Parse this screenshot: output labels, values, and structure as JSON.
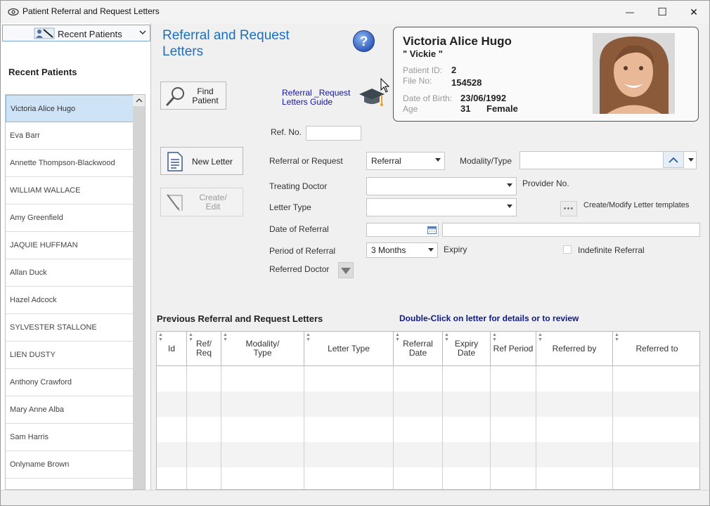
{
  "window": {
    "title": "Patient Referral and Request Letters",
    "app_icon": "eye-icon",
    "minimize_glyph": "—",
    "maximize_glyph": "☐",
    "close_glyph": "✕"
  },
  "sidebar": {
    "combo_label": "Recent Patients",
    "heading": "Recent Patients",
    "patients": [
      "Victoria Alice Hugo",
      "Eva Barr",
      "Annette Thompson-Blackwood",
      "WILLIAM WALLACE",
      "Amy Greenfield",
      "JAQUIE HUFFMAN",
      "Allan  Duck",
      "Hazel Adcock",
      "SYLVESTER STALLONE",
      "LIEN DUSTY",
      "Anthony Crawford",
      "Mary Anne Alba",
      "Sam Harris",
      "Onlyname  Brown"
    ],
    "selected_index": 0
  },
  "header": {
    "title_line1": "Referral and Request",
    "title_line2": "Letters",
    "guide_line1": "Referral _Request",
    "guide_line2": "Letters Guide"
  },
  "buttons": {
    "find_line1": "Find",
    "find_line2": "Patient",
    "new_letter": "New Letter",
    "create_line1": "Create/",
    "create_line2": "Edit"
  },
  "patient": {
    "name": "Victoria Alice Hugo",
    "nickname": "\" Vickie \"",
    "id_label": "Patient ID:",
    "id_value": "2",
    "file_label": "File No:",
    "file_value": "154528",
    "dob_label": "Date of Birth:",
    "dob_value": "23/06/1992",
    "age_label": "Age",
    "age_value": "31",
    "gender": "Female"
  },
  "form": {
    "ref_no_label": "Ref. No.",
    "ref_no_value": "",
    "referral_or_request_label": "Referral or Request",
    "referral_or_request_value": "Referral",
    "modality_label": "Modality/Type",
    "modality_value": "",
    "treating_doctor_label": "Treating Doctor",
    "treating_doctor_value": "",
    "provider_no_label": "Provider No.",
    "letter_type_label": "Letter Type",
    "letter_type_value": "",
    "templates_button_label": "Create/Modify Letter templates",
    "templates_button_glyph": "•••",
    "date_of_referral_label": "Date of Referral",
    "date_of_referral_value": "",
    "date_note_value": "",
    "period_label": "Period of Referral",
    "period_value": "3 Months",
    "expiry_label": "Expiry",
    "indefinite_label": "Indefinite Referral",
    "indefinite_checked": false,
    "referred_doctor_label": "Referred Doctor"
  },
  "grid": {
    "title": "Previous Referral and Request Letters",
    "hint": "Double-Click on letter for details or to review",
    "columns": [
      {
        "l1": "Id",
        "l2": ""
      },
      {
        "l1": "Ref/",
        "l2": "Req"
      },
      {
        "l1": "Modality/",
        "l2": "Type"
      },
      {
        "l1": "Letter Type",
        "l2": ""
      },
      {
        "l1": "Referral",
        "l2": "Date"
      },
      {
        "l1": "Expiry",
        "l2": "Date"
      },
      {
        "l1": "Ref Period",
        "l2": ""
      },
      {
        "l1": "Referred by",
        "l2": ""
      },
      {
        "l1": "Referred to",
        "l2": ""
      }
    ],
    "rows": []
  }
}
